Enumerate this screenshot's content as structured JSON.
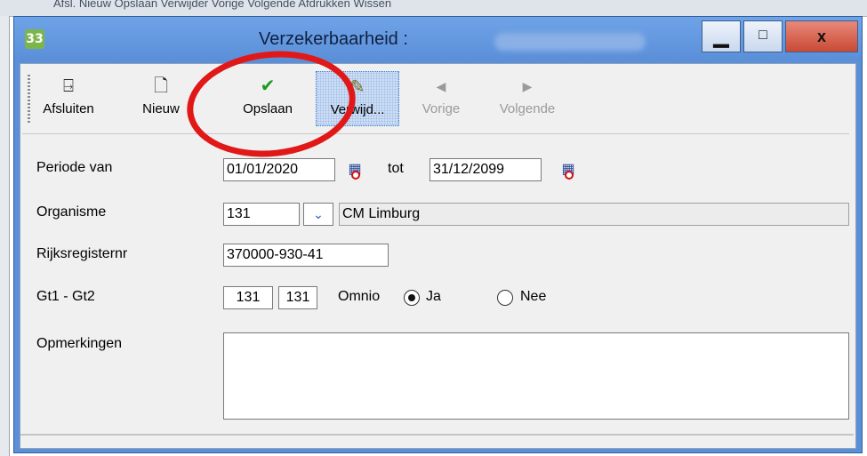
{
  "background": {
    "menu_text": "Afsl.  Nieuw   Opslaan  Verwijder   Vorige   Volgende  Afdrukken                    Wissen"
  },
  "window": {
    "title": "Verzekerbaarheid :",
    "app_icon_text": "33",
    "controls": {
      "minimize": "▁",
      "maximize": "□",
      "close": "x"
    }
  },
  "toolbar": {
    "buttons": [
      {
        "label": "Afsluiten",
        "icon": "exit-door-icon",
        "glyph": "🚪",
        "enabled": true
      },
      {
        "label": "Nieuw",
        "icon": "new-document-icon",
        "glyph": "🗋",
        "enabled": true
      },
      {
        "label": "Opslaan",
        "icon": "checkmark-icon",
        "glyph": "✔",
        "enabled": true
      },
      {
        "label": "Verwijd...",
        "icon": "eraser-icon",
        "glyph": "✎",
        "enabled": true
      },
      {
        "label": "Vorige",
        "icon": "arrow-left-icon",
        "glyph": "◀",
        "enabled": false
      },
      {
        "label": "Volgende",
        "icon": "arrow-right-icon",
        "glyph": "▶",
        "enabled": false
      }
    ]
  },
  "form": {
    "periode_label": "Periode van",
    "periode_from": "01/01/2020",
    "periode_tot_label": "tot",
    "periode_to": "31/12/2099",
    "organisme_label": "Organisme",
    "organisme_code": "131",
    "organisme_name": "CM Limburg",
    "rijksregister_label": "Rijksregisternr",
    "rijksregister_value": "370000-930-41",
    "gt_label": "Gt1 - Gt2",
    "gt1": "131",
    "gt2": "131",
    "omnio_label": "Omnio",
    "omnio_ja": "Ja",
    "omnio_nee": "Nee",
    "omnio_selected": "Ja",
    "opmerkingen_label": "Opmerkingen",
    "opmerkingen_value": ""
  },
  "annotation": {
    "color": "#e01818",
    "target": "Opslaan"
  }
}
